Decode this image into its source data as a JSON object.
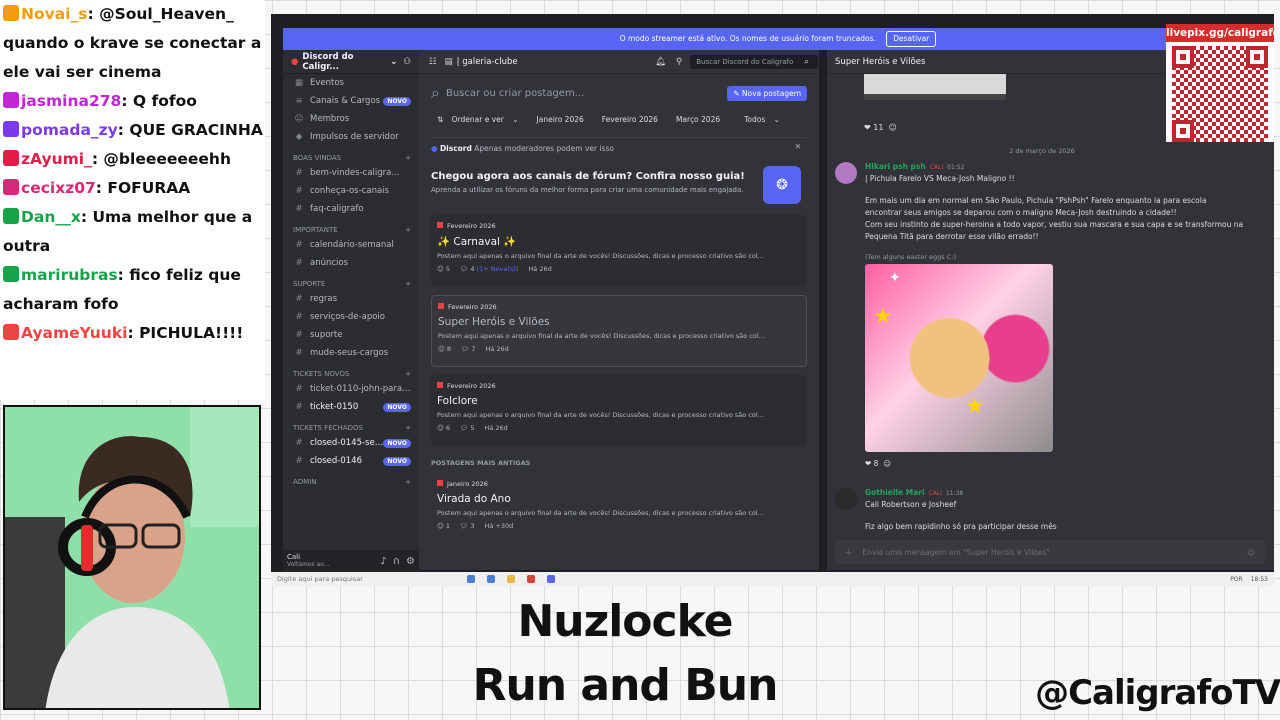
{
  "chat": [
    {
      "user": "Novai_s",
      "user_color": "#f39c12",
      "text": ": @Soul_Heaven_ quando o krave se conectar a ele vai ser cinema"
    },
    {
      "user": "jasmina278",
      "user_color": "#c026d3",
      "text": ": Q fofoo"
    },
    {
      "user": "pomada_zy",
      "user_color": "#7c3aed",
      "text": ": QUE GRACINHA"
    },
    {
      "user": "zAyumi_",
      "user_color": "#e11d48",
      "text": ": @bleeeeeeehh"
    },
    {
      "user": "cecixz07",
      "user_color": "#db2777",
      "text": ": FOFURAA"
    },
    {
      "user": "Dan__x",
      "user_color": "#16a34a",
      "text": ": Uma melhor que a outra"
    },
    {
      "user": "marirubras",
      "user_color": "#16a34a",
      "text": ": fico feliz que acharam fofo"
    },
    {
      "user": "AyameYuuki",
      "user_color": "#ef4444",
      "text": ": PICHULA!!!!"
    }
  ],
  "notice": {
    "text": "O modo streamer está ativo. Os nomes de usuário foram truncados.",
    "button": "Desativar"
  },
  "server": {
    "name": "Discord do Caligr...",
    "top_items": [
      {
        "icon": "calendar-icon",
        "glyph": "▦",
        "label": "Eventos"
      },
      {
        "icon": "channels-roles-icon",
        "glyph": "≡",
        "label": "Canais & Cargos",
        "badge": "NOVO"
      },
      {
        "icon": "members-icon",
        "glyph": "☺",
        "label": "Membros"
      },
      {
        "icon": "boost-icon",
        "glyph": "◆",
        "label": "Impulsos de servidor"
      }
    ],
    "categories": [
      {
        "name": "BOAS VINDAS",
        "channels": [
          "bem-vindes-caligra...",
          "conheça-os-canais",
          "faq-caligrafo"
        ]
      },
      {
        "name": "IMPORTANTE",
        "channels": [
          "calendário-semanal",
          "anúncios"
        ]
      },
      {
        "name": "SUPORTE",
        "channels": [
          "regras",
          "serviços-de-apoio",
          "suporte",
          "mude-seus-cargos"
        ]
      },
      {
        "name": "TICKETS NOVOS",
        "channels": [
          "ticket-0110-john-parano...",
          "ticket-0150"
        ]
      },
      {
        "name": "TICKETS FECHADOS",
        "channels": [
          "closed-0145-ser...",
          "closed-0146"
        ]
      },
      {
        "name": "ADMIN",
        "channels": []
      }
    ],
    "badge_new": "NOVO",
    "user": {
      "name": "Cali",
      "status": "Voltamos ao..."
    }
  },
  "forum": {
    "channel": "| galeria-clube",
    "search_placeholder": "Buscar Discord do Caligrafo",
    "post_search": "Buscar ou criar postagem...",
    "new_post": "Nova postagem",
    "sort": "Ordenar e ver",
    "filters": [
      "Janeiro 2026",
      "Fevereiro 2026",
      "Março 2026",
      "Todos"
    ],
    "guide": {
      "source": "Discord",
      "note": "Apenas moderadores podem ver isso",
      "title": "Chegou agora aos canais de fórum? Confira nosso guia!",
      "sub": "Aprenda a utilizar os fóruns da melhor forma para criar uma comunidade mais engajada."
    },
    "posts": [
      {
        "tag": "Fevereiro 2026",
        "title": "✨ Carnaval ✨",
        "excerpt": "Postem aqui apenas o arquivo final da arte de vocês! Discussões, dicas e processo criativo são col...",
        "members": "5",
        "replies": "4",
        "new": "(1+ Nova(s))",
        "age": "Há 26d"
      },
      {
        "tag": "Fevereiro 2026",
        "title": "Super Heróis e Vilões",
        "excerpt": "Postem aqui apenas o arquivo final da arte de vocês! Discussões, dicas e processo criativo são col...",
        "members": "8",
        "replies": "7",
        "new": "",
        "age": "Há 26d"
      },
      {
        "tag": "Fevereiro 2026",
        "title": "Folclore",
        "excerpt": "Postem aqui apenas o arquivo final da arte de vocês! Discussões, dicas e processo criativo são col...",
        "members": "6",
        "replies": "5",
        "new": "",
        "age": "Há 26d"
      }
    ],
    "older_label": "POSTAGENS MAIS ANTIGAS",
    "older_post": {
      "tag": "Janeiro 2026",
      "title": "Virada do Ano",
      "excerpt": "Postem aqui apenas o arquivo final da arte de vocês! Discussões, dicas e processo criativo são col...",
      "members": "1",
      "replies": "3",
      "age": "Há +30d"
    }
  },
  "thread": {
    "title": "Super Heróis e Vilões",
    "top_reaction": "11",
    "date_divider": "2 de março de 2026",
    "msg1": {
      "author": "Hikari psh psh",
      "tag": "CALI",
      "time": "01:52",
      "lines": [
        "| Pichula Farelo VS Meca-Josh Maligno !!",
        "Em mais um dia em normal em São Paulo, Pichula \"PshPsh\" Farelo enquanto ia para escola encontrar seus amigos se deparou com o maligno Meca-Josh destruindo a cidade!!",
        "Com seu instinto de super-heroina a todo vapor, vestiu sua mascara e sua capa e se transformou na Pequena Titã para derrotar esse vilão errado!!"
      ],
      "caption": "(Tem alguns easter eggs C:)",
      "reactions": "8"
    },
    "msg2": {
      "author": "Gothielle Mari",
      "tag": "CALI",
      "time": "11:38",
      "lines": [
        "Cali Robertson e Josheef",
        "Fiz algo bem rapidinho só pra participar desse mês"
      ]
    },
    "composer": "Envie uma mensagem em \"Super Heróis e Vilões\""
  },
  "taskbar": {
    "search": "Digite aqui para pesquisar",
    "lang": "POR",
    "time": "18:53"
  },
  "overlay": {
    "qr_link": "livepix.gg/caligrafo",
    "title1": "Nuzlocke",
    "title2": "Run and Bun",
    "handle": "@CaligrafoTV"
  }
}
